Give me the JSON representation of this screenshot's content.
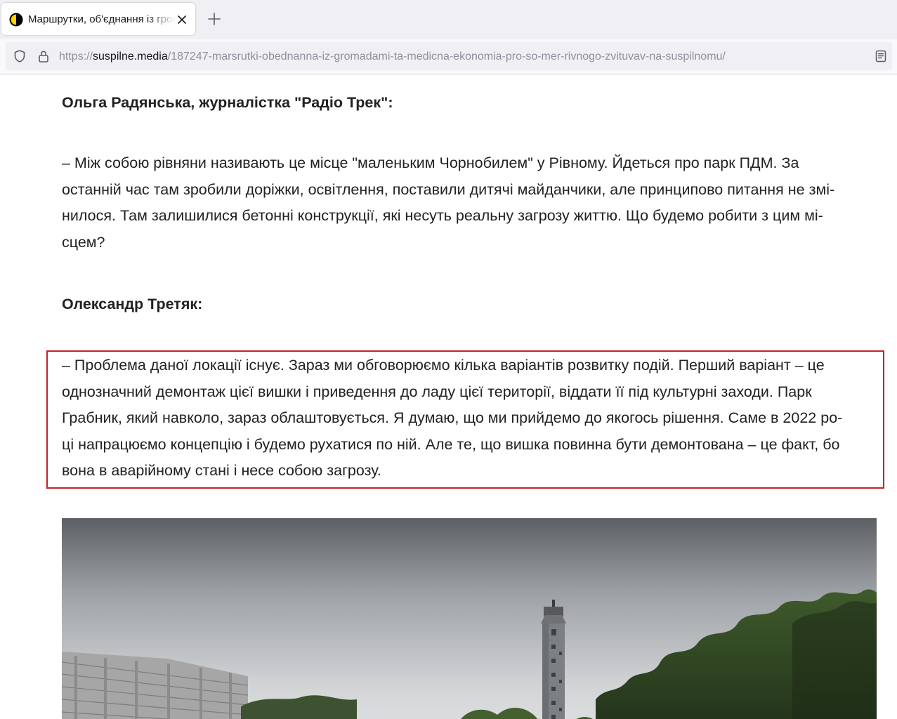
{
  "browser": {
    "tab": {
      "title": "Маршрутки, об'єднання із громадами та медична економія — про що мер Рівного звітував на Суспільному"
    },
    "url": {
      "scheme": "https://",
      "domain": "suspilne.media",
      "path": "/187247-marsrutki-obednanna-iz-gromadami-ta-medicna-ekonomia-pro-so-mer-rivnogo-zvituvav-na-suspilnomu/"
    }
  },
  "article": {
    "speaker_1": "Ольга Радянська, журналістка \"Радіо Трек\":",
    "question_lines": [
      "– Між собою рівняни називають це місце \"маленьким Чорнобилем\" у Рівному. Йдеться про парк ПДМ. За",
      "останній час там зробили доріжки, освітлення, поставили дитячі майданчики, але принципово питання не змі-",
      "нилося. Там залишилися бетонні конструкції, які несуть реальну загрозу життю. Що будемо робити з цим мі-",
      "сцем?"
    ],
    "speaker_2": "Олександр Третяк:",
    "answer_lines": [
      "– Проблема даної локації існує. Зараз ми обговорюємо кілька варіантів розвитку подій. Перший варіант – це",
      "однозначний демонтаж цієї вишки і приведення до ладу цієї території, віддати її під культурні заходи. Парк",
      "Грабник, який навколо, зараз облаштовується. Я думаю, що ми прийдемо до якогось рішення. Саме в 2022 ро-",
      "ці напрацюємо концепцію і будемо рухатися по ній. Але те, що вишка повинна бути демонтована – це факт, бо",
      "вона в аварійному стані і несе собою загрозу."
    ]
  },
  "colors": {
    "highlight_border": "#c4232b",
    "body_text": "#222222"
  }
}
